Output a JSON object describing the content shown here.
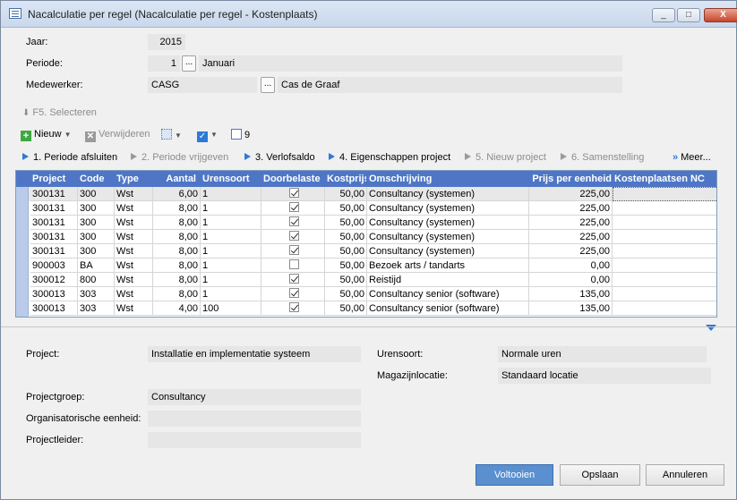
{
  "window": {
    "title": "Nacalculatie per regel (Nacalculatie per regel - Kostenplaats)",
    "min": "_",
    "max": "□",
    "close": "X"
  },
  "header": {
    "jaar_label": "Jaar:",
    "jaar_value": "2015",
    "periode_label": "Periode:",
    "periode_value": "1",
    "periode_name": "Januari",
    "medewerker_label": "Medewerker:",
    "medewerker_code": "CASG",
    "medewerker_name": "Cas de Graaf",
    "dots": "..."
  },
  "toolbar": {
    "selecteren": "F5. Selecteren",
    "nieuw": "Nieuw",
    "verwijderen": "Verwijderen",
    "count": "9"
  },
  "steps": {
    "s1": "1. Periode afsluiten",
    "s2": "2. Periode vrijgeven",
    "s3": "3. Verlofsaldo",
    "s4": "4. Eigenschappen project",
    "s5": "5. Nieuw project",
    "s6": "6. Samenstelling",
    "meer": "Meer..."
  },
  "table": {
    "columns": [
      "Project",
      "Code",
      "Type",
      "Aantal",
      "Urensoort",
      "Doorbelaste",
      "Kostprijs",
      "Omschrijving",
      "Prijs per eenheid",
      "Kostenplaatsen NC"
    ],
    "rows": [
      {
        "project": "300131",
        "code": "300",
        "type": "Wst",
        "aantal": "6,00",
        "urensoort": "1",
        "checked": true,
        "kostprijs": "50,00",
        "omschrijving": "Consultancy (systemen)",
        "prijs": "225,00"
      },
      {
        "project": "300131",
        "code": "300",
        "type": "Wst",
        "aantal": "8,00",
        "urensoort": "1",
        "checked": true,
        "kostprijs": "50,00",
        "omschrijving": "Consultancy (systemen)",
        "prijs": "225,00"
      },
      {
        "project": "300131",
        "code": "300",
        "type": "Wst",
        "aantal": "8,00",
        "urensoort": "1",
        "checked": true,
        "kostprijs": "50,00",
        "omschrijving": "Consultancy (systemen)",
        "prijs": "225,00"
      },
      {
        "project": "300131",
        "code": "300",
        "type": "Wst",
        "aantal": "8,00",
        "urensoort": "1",
        "checked": true,
        "kostprijs": "50,00",
        "omschrijving": "Consultancy (systemen)",
        "prijs": "225,00"
      },
      {
        "project": "300131",
        "code": "300",
        "type": "Wst",
        "aantal": "8,00",
        "urensoort": "1",
        "checked": true,
        "kostprijs": "50,00",
        "omschrijving": "Consultancy (systemen)",
        "prijs": "225,00"
      },
      {
        "project": "900003",
        "code": "BA",
        "type": "Wst",
        "aantal": "8,00",
        "urensoort": "1",
        "checked": false,
        "kostprijs": "50,00",
        "omschrijving": "Bezoek arts / tandarts",
        "prijs": "0,00"
      },
      {
        "project": "300012",
        "code": "800",
        "type": "Wst",
        "aantal": "8,00",
        "urensoort": "1",
        "checked": true,
        "kostprijs": "50,00",
        "omschrijving": "Reistijd",
        "prijs": "0,00"
      },
      {
        "project": "300013",
        "code": "303",
        "type": "Wst",
        "aantal": "8,00",
        "urensoort": "1",
        "checked": true,
        "kostprijs": "50,00",
        "omschrijving": "Consultancy senior (software)",
        "prijs": "135,00"
      },
      {
        "project": "300013",
        "code": "303",
        "type": "Wst",
        "aantal": "4,00",
        "urensoort": "100",
        "checked": true,
        "kostprijs": "50,00",
        "omschrijving": "Consultancy senior (software)",
        "prijs": "135,00"
      }
    ]
  },
  "details": {
    "project_label": "Project:",
    "project_value": "Installatie en implementatie systeem",
    "urensoort_label": "Urensoort:",
    "urensoort_value": "Normale uren",
    "magazijn_label": "Magazijnlocatie:",
    "magazijn_value": "Standaard locatie",
    "projectgroep_label": "Projectgroep:",
    "projectgroep_value": "Consultancy",
    "org_label": "Organisatorische eenheid:",
    "org_value": "",
    "leider_label": "Projectleider:",
    "leider_value": ""
  },
  "buttons": {
    "voltooien": "Voltooien",
    "opslaan": "Opslaan",
    "annuleren": "Annuleren"
  },
  "colors": {
    "header": "#4f76c6",
    "primary": "#5a8fd0",
    "step_arrow": "#2f79d6"
  }
}
